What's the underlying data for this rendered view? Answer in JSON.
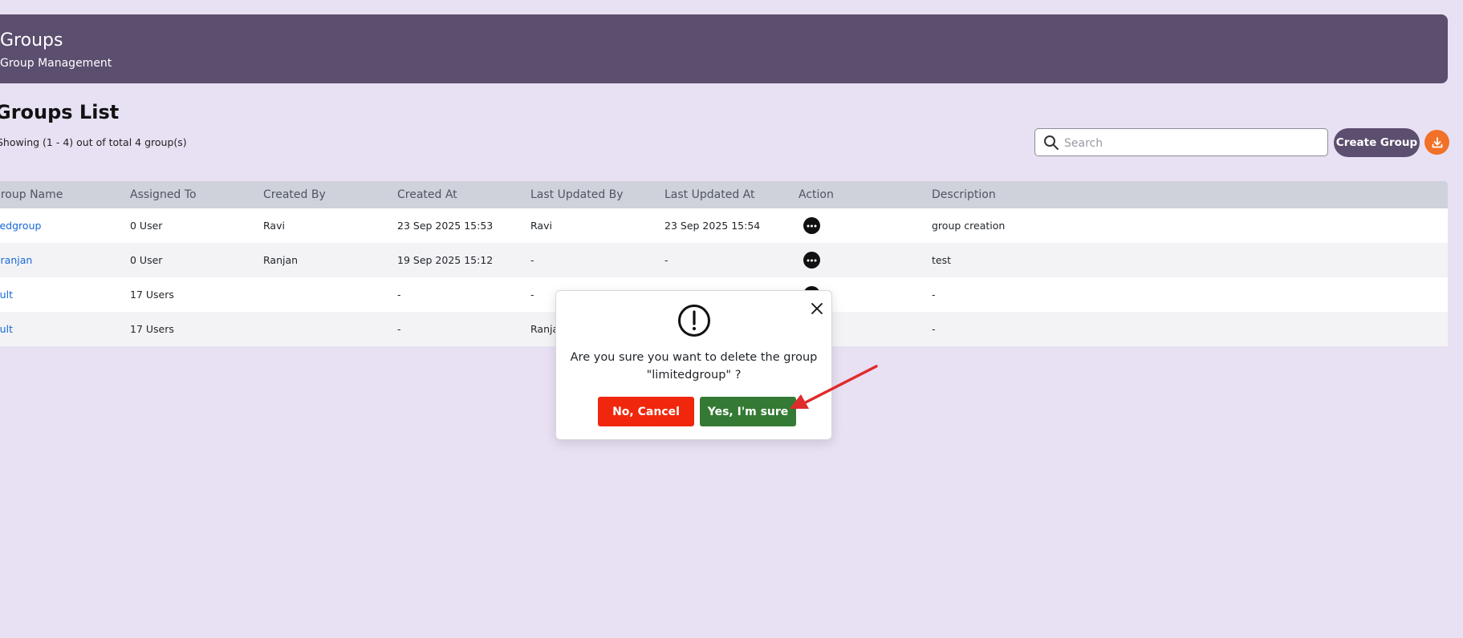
{
  "header": {
    "title": "Groups",
    "subtitle": "Group Management"
  },
  "list": {
    "title": "Groups List",
    "count_text": "Showing (1 - 4) out of total 4 group(s)"
  },
  "search": {
    "placeholder": "Search",
    "value": ""
  },
  "toolbar": {
    "create_label": "Create Group",
    "download_icon": "download-icon"
  },
  "table": {
    "columns": [
      "Group Name",
      "Assigned To",
      "Created By",
      "Created At",
      "Last Updated By",
      "Last Updated At",
      "Action",
      "Description"
    ],
    "rows": [
      {
        "name": "limitedgroup",
        "assigned": "0 User",
        "created_by": "Ravi",
        "created_at": "23 Sep 2025 15:53",
        "updated_by": "Ravi",
        "updated_at": "23 Sep 2025 15:54",
        "description": "group creation"
      },
      {
        "name": "test-ranjan",
        "assigned": "0 User",
        "created_by": "Ranjan",
        "created_at": "19 Sep 2025 15:12",
        "updated_by": "-",
        "updated_at": "-",
        "description": "test"
      },
      {
        "name": "default",
        "assigned": "17 Users",
        "created_by": "",
        "created_at": "-",
        "updated_by": "-",
        "updated_at": "",
        "description": "-"
      },
      {
        "name": "default",
        "assigned": "17 Users",
        "created_by": "",
        "created_at": "-",
        "updated_by": "Ranjan",
        "updated_at": "",
        "description": "-"
      }
    ]
  },
  "modal": {
    "message": "Are you sure you want to delete the group \"limitedgroup\" ?",
    "cancel_label": "No, Cancel",
    "confirm_label": "Yes, I'm sure"
  },
  "colors": {
    "header_bg": "#5c4e6f",
    "page_bg": "#e8e0f3",
    "accent_orange": "#f07127",
    "cancel_red": "#f0270d",
    "confirm_green": "#347a34",
    "link_blue": "#1769d6",
    "annotation_arrow": "#e02b2b"
  }
}
